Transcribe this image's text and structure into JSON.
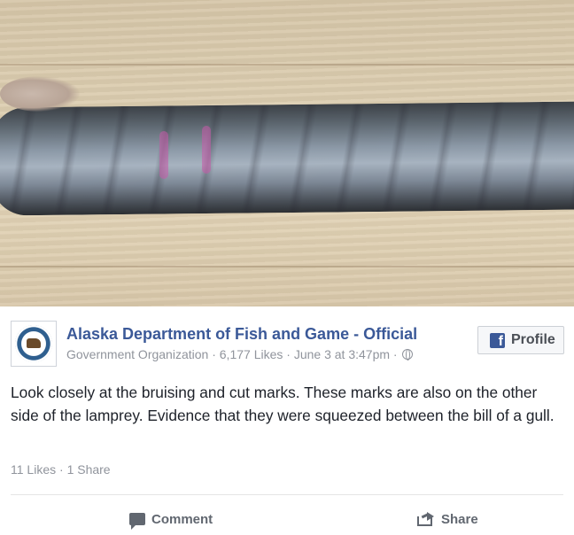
{
  "post": {
    "image_alt": "Lamprey on a wooden surface showing bruising and cut marks",
    "page_name": "Alaska Department of Fish and Game - Official",
    "category": "Government Organization",
    "likes": "6,177 Likes",
    "date": "June 3 at 3:47pm",
    "separator": "·",
    "privacy_icon": "globe-icon",
    "profile_button_label": "Profile",
    "profile_button_icon": "facebook-icon",
    "text": "Look closely at the bruising and cut marks. These marks are also on the other side of the lamprey. Evidence that they were squeezed between the bill of a gull.",
    "reactions": {
      "likes": "11 Likes",
      "shares": "1 Share"
    },
    "actions": {
      "comment_label": "Comment",
      "share_label": "Share"
    }
  },
  "colors": {
    "brand": "#3b5998",
    "meta_text": "#90949c",
    "body_text": "#1d2129",
    "action_text": "#616770"
  }
}
